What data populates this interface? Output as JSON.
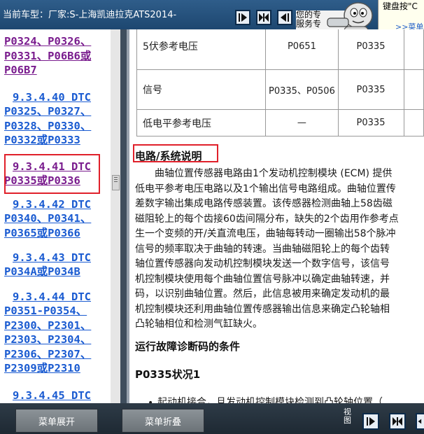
{
  "header": {
    "vehicle_label": "当前车型：厂家:S-上海凯迪拉克ATS2014-",
    "prompt_lines": [
      "您的专",
      "服务专"
    ],
    "tip_line": "键盘按\"C",
    "tip_link": ">>菜单"
  },
  "nav": {
    "items": [
      {
        "lines": [
          "P0324、P0326、",
          "P0331、P06B6或",
          "P06B7"
        ],
        "visited": true
      },
      {
        "lines": [
          "9.3.4.40 DTC",
          "P0325、P0327、",
          "P0328、P0330、",
          "P0332或P0333"
        ],
        "visited": false
      },
      {
        "lines": [
          "9.3.4.41 DTC",
          "P0335或P0336"
        ],
        "visited": true
      },
      {
        "lines": [
          "9.3.4.42 DTC",
          "P0340、P0341、",
          "P0365或P0366"
        ],
        "visited": false
      },
      {
        "lines": [
          "9.3.4.43 DTC",
          "P034A或P034B"
        ],
        "visited": false
      },
      {
        "lines": [
          "9.3.4.44 DTC",
          "P0351-P0354、",
          "P2300、P2301、",
          "P2303、P2304、",
          "P2306、P2307、",
          "P2309或P2310"
        ],
        "visited": false
      },
      {
        "lines": [
          "9.3.4.45 DTC"
        ],
        "visited": false
      }
    ]
  },
  "content": {
    "table_rows": [
      {
        "label": "5伏参考电压",
        "a": "P0651",
        "b": "P0335",
        "c": ""
      },
      {
        "label": "信号",
        "a": "P0335、P0506",
        "b": "P0335",
        "c": ""
      },
      {
        "label": "低电平参考电压",
        "a": "—",
        "b": "P0335",
        "c": ""
      }
    ],
    "section_heading": "电路/系统说明",
    "paragraph": [
      "曲轴位置传感器电路由1个发动机控制模块 (ECM) 提供",
      "低电平参考电压电路以及1个输出信号电路组成。曲轴位置传",
      "差数字输出集成电路传感装置。该传感器检测曲轴上58齿磁",
      "磁阻轮上的每个齿接60齿间隔分布，缺失的2个齿用作参考点",
      "生一个变频的开/关直流电压，曲轴每转动一圈输出58个脉冲",
      "信号的频率取决于曲轴的转速。当曲轴磁阻轮上的每个齿转",
      "轴位置传感器向发动机控制模块发送一个数字信号，该信号",
      "机控制模块使用每个曲轴位置信号脉冲以确定曲轴转速，并",
      "码，以识别曲轴位置。然后，此信息被用来确定发动机的最",
      "机控制模块还利用曲轴位置传感器输出信息来确定凸轮轴相",
      "凸轮轴相位和检测气缸缺火。"
    ],
    "conditions_heading": "运行故障诊断码的条件",
    "p0335_heading": "P0335状况1",
    "bullet": "起动机接合，且发动机控制模块检测到凸轮轴位置（"
  },
  "footer": {
    "expand_label": "菜单展开",
    "collapse_label": "菜单折叠",
    "view_label": "视图"
  }
}
